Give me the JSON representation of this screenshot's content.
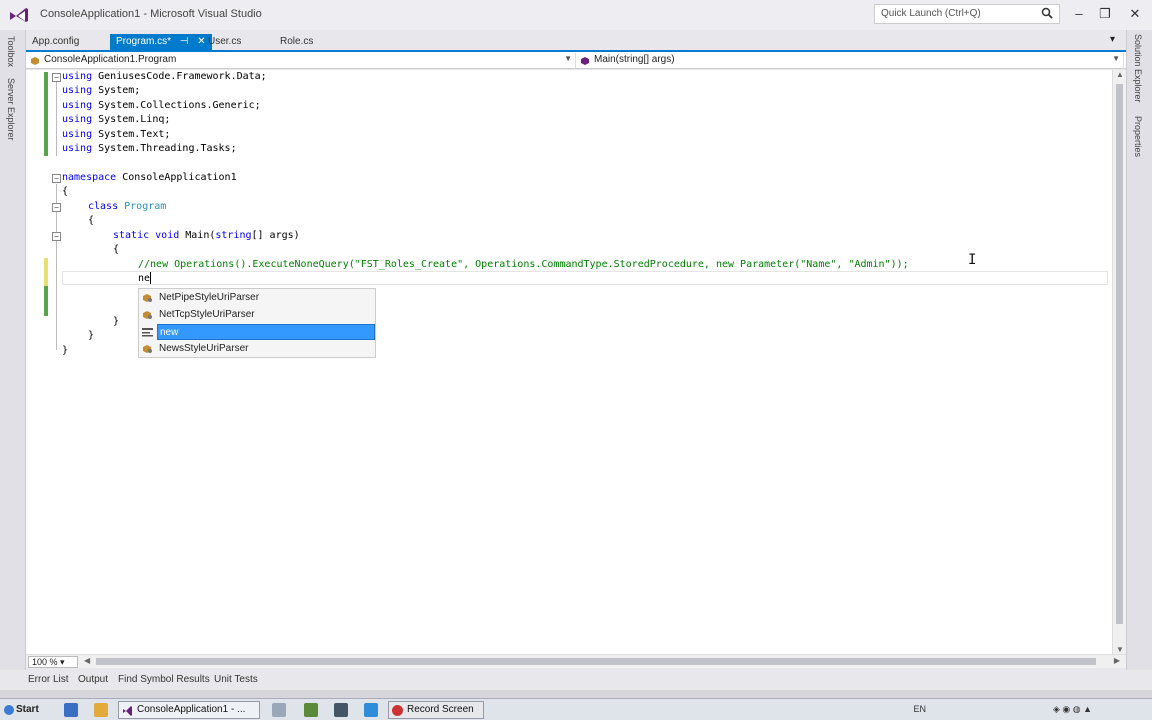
{
  "window": {
    "title": "ConsoleApplication1 - Microsoft Visual Studio",
    "quick_launch_placeholder": "Quick Launch (Ctrl+Q)",
    "minimize": "–",
    "restore": "❐",
    "close": "✕"
  },
  "left_rail": {
    "items": [
      "Toolbox",
      "Server Explorer"
    ]
  },
  "right_rail": {
    "items": [
      "Solution Explorer",
      "Properties"
    ]
  },
  "tabs": [
    {
      "label": "App.config",
      "active": false
    },
    {
      "label": "Program.cs*",
      "active": true,
      "pin": "⊣",
      "close": "✕"
    },
    {
      "label": "User.cs",
      "active": false
    },
    {
      "label": "Role.cs",
      "active": false
    }
  ],
  "navbar": {
    "class_selector": "ConsoleApplication1.Program",
    "member_selector": "Main(string[] args)"
  },
  "code": {
    "l1": [
      "using",
      " GeniusesCode.Framework.Data;"
    ],
    "l2": [
      "using",
      " System;"
    ],
    "l3": [
      "using",
      " System.Collections.Generic;"
    ],
    "l4": [
      "using",
      " System.Linq;"
    ],
    "l5": [
      "using",
      " System.Text;"
    ],
    "l6": [
      "using",
      " System.Threading.Tasks;"
    ],
    "l8": [
      "namespace",
      " ConsoleApplication1"
    ],
    "l9": "{",
    "l10": [
      "class",
      " ",
      "Program"
    ],
    "l11": "{",
    "l12": [
      "static",
      " ",
      "void",
      " Main(",
      "string",
      "[] args)"
    ],
    "l13": "{",
    "l14": "//new Operations().ExecuteNoneQuery(\"FST_Roles_Create\", Operations.CommandType.StoredProcedure, new Parameter(\"Name\", \"Admin\"));",
    "l15": "ne",
    "l17": "}",
    "l18": "}",
    "l19": "}"
  },
  "intellisense": {
    "items": [
      {
        "label": "NetPipeStyleUriParser",
        "icon": "class-icon",
        "selected": false
      },
      {
        "label": "NetTcpStyleUriParser",
        "icon": "class-icon",
        "selected": false
      },
      {
        "label": "new",
        "icon": "keyword-icon",
        "selected": true
      },
      {
        "label": "NewsStyleUriParser",
        "icon": "class-icon",
        "selected": false
      }
    ]
  },
  "zoom": "100 %",
  "bottom_tabs": [
    "Error List",
    "Output",
    "Find Symbol Results",
    "Unit Tests"
  ],
  "taskbar": {
    "start": "Start",
    "active_task": "ConsoleApplication1 - ...",
    "second_task": "Record Screen",
    "lang": "EN"
  },
  "colors": {
    "accent": "#007acc",
    "keyword": "#0000ff",
    "type": "#2b91af",
    "comment": "#008000",
    "selection": "#3399ff",
    "changed_margin": "#e8e06a",
    "saved_margin": "#57a64a"
  }
}
